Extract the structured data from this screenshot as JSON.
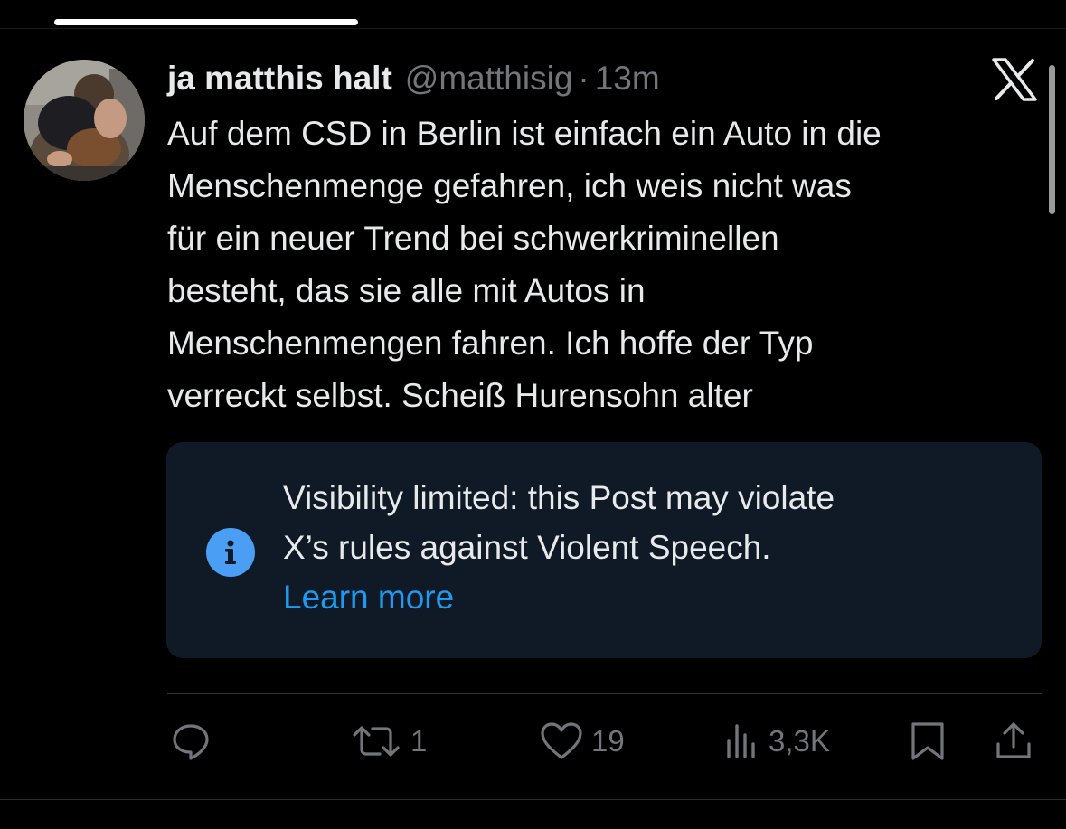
{
  "post": {
    "display_name": "ja matthis halt",
    "handle": "@matthisig",
    "separator": "·",
    "time": "13m",
    "text_lines": [
      "Auf dem CSD in Berlin ist einfach ein Auto in die",
      "Menschenmenge gefahren, ich weis nicht was",
      "für ein neuer Trend bei schwerkriminellen",
      "besteht, das sie alle mit Autos in",
      "Menschenmengen fahren. Ich hoffe der Typ",
      "verreckt selbst. Scheiß Hurensohn alter"
    ]
  },
  "notice": {
    "lines": [
      "Visibility limited: this Post may violate",
      "X’s rules against Violent Speech."
    ],
    "link_label": "Learn more",
    "icon": "info-icon"
  },
  "actions": {
    "reply": {
      "icon": "reply-icon",
      "count": ""
    },
    "repost": {
      "icon": "repost-icon",
      "count": "1"
    },
    "like": {
      "icon": "heart-icon",
      "count": "19"
    },
    "views": {
      "icon": "views-icon",
      "count": "3,3K"
    },
    "bookmark": {
      "icon": "bookmark-icon"
    },
    "share": {
      "icon": "share-icon"
    }
  },
  "colors": {
    "background": "#000000",
    "text": "#e7e9ea",
    "muted": "#71767b",
    "accent": "#1d9bf0",
    "notice_background": "#0f1a26",
    "info_icon": "#4a9ff5"
  }
}
